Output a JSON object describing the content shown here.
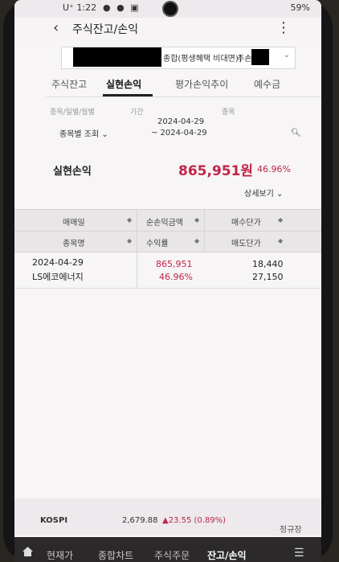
{
  "status": {
    "carrier": "U⁺",
    "time": "1:22",
    "battery": "59%"
  },
  "header": {
    "title": "주식잔고/손익"
  },
  "account": {
    "type": "종합(평생혜택 비대면)]",
    "kind": "주손"
  },
  "tabs": [
    {
      "label": "주식잔고"
    },
    {
      "label": "실현손익"
    },
    {
      "label": "평가손익추이"
    },
    {
      "label": "예수금"
    }
  ],
  "filters": {
    "by_label": "종목/일별/월별",
    "period_label": "기간",
    "stock_label": "종목",
    "by_value": "종목별 조회",
    "period_from": "2024-04-29",
    "period_to": "~ 2024-04-29"
  },
  "summary": {
    "label": "실현손익",
    "amount": "865,951원",
    "rate": "46.96%",
    "detail": "상세보기"
  },
  "table": {
    "headers": {
      "trade_date": "매매일",
      "net_pl": "순손익금액",
      "buy_price": "매수단가",
      "stock_name": "종목명",
      "return_rate": "수익률",
      "sell_price": "매도단가"
    },
    "rows": [
      {
        "trade_date": "2024-04-29",
        "stock_name": "LS에코에너지",
        "net_pl": "865,951",
        "return_rate": "46.96%",
        "buy_price": "18,440",
        "sell_price": "27,150"
      }
    ]
  },
  "ticker": [
    {
      "name": "",
      "value": "",
      "change": ""
    },
    {
      "name": "KOSPI",
      "value": "2,679.88",
      "change": "▲23.55 (0.89%)"
    }
  ],
  "regulation": "정규장",
  "bottom_nav": [
    {
      "label": "현재가"
    },
    {
      "label": "종합차트"
    },
    {
      "label": "주식주문"
    },
    {
      "label": "잔고/손익"
    }
  ],
  "colors": {
    "accent_red": "#c0254a",
    "nav_bg": "#2b2929"
  }
}
